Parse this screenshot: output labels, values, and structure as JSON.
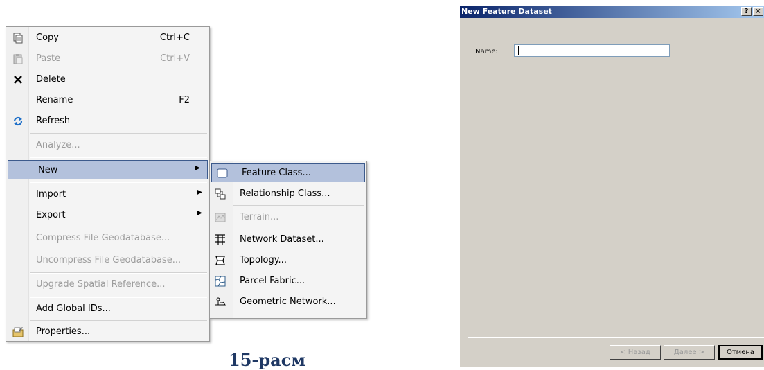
{
  "context_menu": {
    "items": [
      {
        "label": "Copy",
        "shortcut": "Ctrl+C",
        "icon": "copy-icon"
      },
      {
        "label": "Paste",
        "shortcut": "Ctrl+V",
        "icon": "paste-icon"
      },
      {
        "label": "Delete",
        "icon": "delete-icon"
      },
      {
        "label": "Rename",
        "shortcut": "F2"
      },
      {
        "label": "Refresh",
        "icon": "refresh-icon"
      },
      {
        "label": "Analyze..."
      },
      {
        "label": "New",
        "submenu": true
      },
      {
        "label": "Import",
        "submenu": true
      },
      {
        "label": "Export",
        "submenu": true
      },
      {
        "label": "Compress File Geodatabase..."
      },
      {
        "label": "Uncompress File Geodatabase..."
      },
      {
        "label": "Upgrade Spatial Reference..."
      },
      {
        "label": "Add Global IDs..."
      },
      {
        "label": "Properties...",
        "icon": "properties-icon"
      }
    ]
  },
  "submenu": {
    "items": [
      {
        "label": "Feature Class...",
        "icon": "feature-class-icon"
      },
      {
        "label": "Relationship Class...",
        "icon": "relationship-class-icon"
      },
      {
        "label": "Terrain...",
        "icon": "terrain-icon"
      },
      {
        "label": "Network Dataset...",
        "icon": "network-dataset-icon"
      },
      {
        "label": "Topology...",
        "icon": "topology-icon"
      },
      {
        "label": "Parcel Fabric...",
        "icon": "parcel-fabric-icon"
      },
      {
        "label": "Geometric Network...",
        "icon": "geometric-network-icon"
      }
    ]
  },
  "caption": "15-расм",
  "dialog": {
    "title": "New Feature Dataset",
    "help_glyph": "?",
    "close_glyph": "×",
    "name_label": "Name:",
    "name_value": "",
    "back_label": "< Назад",
    "next_label": "Далее >",
    "cancel_label": "Отмена"
  }
}
